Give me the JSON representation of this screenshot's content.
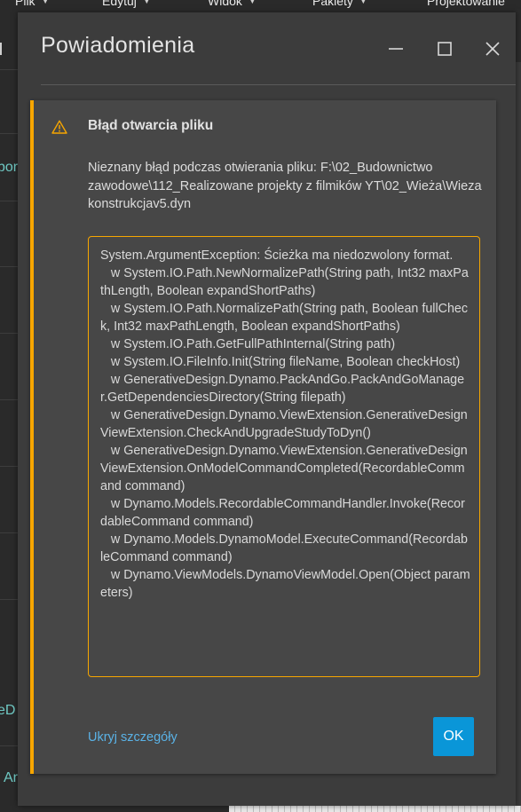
{
  "background": {
    "menu": [
      {
        "label": "Plik"
      },
      {
        "label": "Edytuj"
      },
      {
        "label": "Widok"
      },
      {
        "label": "Pakiety"
      },
      {
        "label": "Projektowanie"
      }
    ],
    "left_fragments": [
      {
        "text": "bor"
      },
      {
        "text": "eD"
      },
      {
        "text": "Ar"
      }
    ]
  },
  "dialog": {
    "title": "Powiadomienia",
    "notification": {
      "title": "Błąd otwarcia pliku",
      "message": "Nieznany błąd podczas otwierania pliku: F:\\02_Budownictwo zawodowe\\112_Realizowane projekty z filmików YT\\02_Wieża\\Wieza konstrukcjav5.dyn",
      "details": "System.ArgumentException: Ścieżka ma niedozwolony format.\n   w System.IO.Path.NewNormalizePath(String path, Int32 maxPathLength, Boolean expandShortPaths)\n   w System.IO.Path.NormalizePath(String path, Boolean fullCheck, Int32 maxPathLength, Boolean expandShortPaths)\n   w System.IO.Path.GetFullPathInternal(String path)\n   w System.IO.FileInfo.Init(String fileName, Boolean checkHost)\n   w GenerativeDesign.Dynamo.PackAndGo.PackAndGoManager.GetDependenciesDirectory(String filepath)\n   w GenerativeDesign.Dynamo.ViewExtension.GenerativeDesignViewExtension.CheckAndUpgradeStudyToDyn()\n   w GenerativeDesign.Dynamo.ViewExtension.GenerativeDesignViewExtension.OnModelCommandCompleted(RecordableCommand command)\n   w Dynamo.Models.RecordableCommandHandler.Invoke(RecordableCommand command)\n   w Dynamo.Models.DynamoModel.ExecuteCommand(RecordableCommand command)\n   w Dynamo.ViewModels.DynamoViewModel.Open(Object parameters)",
      "hide_details_label": "Ukryj szczegóły",
      "ok_label": "OK",
      "icon": "warning-icon"
    }
  },
  "colors": {
    "accent_orange": "#f7a600",
    "ok_blue": "#0a96d8",
    "link_blue": "#5ab2e6",
    "background_teal": "#6fc9c4"
  }
}
